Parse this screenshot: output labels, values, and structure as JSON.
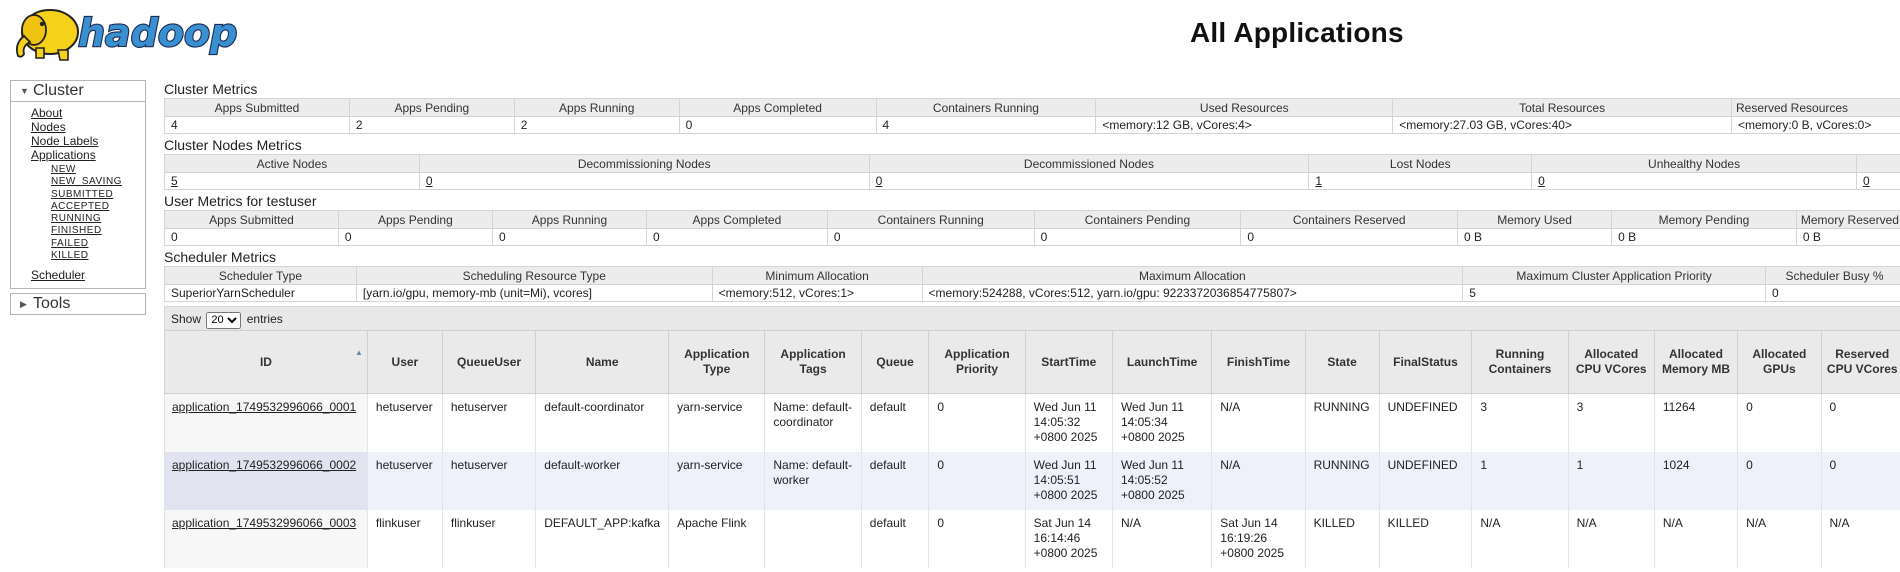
{
  "page": {
    "title": "All Applications"
  },
  "sidebar": {
    "cluster": {
      "header": "Cluster",
      "links": [
        "About",
        "Nodes",
        "Node Labels",
        "Applications"
      ],
      "app_states": [
        "NEW",
        "NEW_SAVING",
        "SUBMITTED",
        "ACCEPTED",
        "RUNNING",
        "FINISHED",
        "FAILED",
        "KILLED"
      ],
      "scheduler": "Scheduler"
    },
    "tools": {
      "header": "Tools"
    }
  },
  "cluster_metrics": {
    "title": "Cluster Metrics",
    "headers": [
      "Apps Submitted",
      "Apps Pending",
      "Apps Running",
      "Apps Completed",
      "Containers Running",
      "Used Resources",
      "Total Resources",
      "Reserved Resources"
    ],
    "values": [
      "4",
      "2",
      "2",
      "0",
      "4",
      "<memory:12 GB, vCores:4>",
      "<memory:27.03 GB, vCores:40>",
      "<memory:0 B, vCores:0>"
    ]
  },
  "cluster_nodes_metrics": {
    "title": "Cluster Nodes Metrics",
    "headers": [
      "Active Nodes",
      "Decommissioning Nodes",
      "Decommissioned Nodes",
      "Lost Nodes",
      "Unhealthy Nodes",
      ""
    ],
    "values": [
      "5",
      "0",
      "0",
      "1",
      "0",
      "0"
    ]
  },
  "user_metrics": {
    "title": "User Metrics for testuser",
    "headers": [
      "Apps Submitted",
      "Apps Pending",
      "Apps Running",
      "Apps Completed",
      "Containers Running",
      "Containers Pending",
      "Containers Reserved",
      "Memory Used",
      "Memory Pending",
      "Memory Reserved"
    ],
    "values": [
      "0",
      "0",
      "0",
      "0",
      "0",
      "0",
      "0",
      "0 B",
      "0 B",
      "0 B"
    ]
  },
  "scheduler_metrics": {
    "title": "Scheduler Metrics",
    "headers": [
      "Scheduler Type",
      "Scheduling Resource Type",
      "Minimum Allocation",
      "Maximum Allocation",
      "Maximum Cluster Application Priority",
      "Scheduler Busy %"
    ],
    "values": [
      "SuperiorYarnScheduler",
      "[yarn.io/gpu, memory-mb (unit=Mi), vcores]",
      "<memory:512, vCores:1>",
      "<memory:524288, vCores:512, yarn.io/gpu: 9223372036854775807>",
      "5",
      "0"
    ]
  },
  "apps_table": {
    "show_label": "Show",
    "entries_value": "20",
    "entries_label": "entries",
    "headers": [
      "ID",
      "User",
      "QueueUser",
      "Name",
      "Application Type",
      "Application Tags",
      "Queue",
      "Application Priority",
      "StartTime",
      "LaunchTime",
      "FinishTime",
      "State",
      "FinalStatus",
      "Running Containers",
      "Allocated CPU VCores",
      "Allocated Memory MB",
      "Allocated GPUs",
      "Reserved CPU VCores"
    ],
    "rows": [
      [
        "application_1749532996066_0001",
        "hetuserver",
        "hetuserver",
        "default-coordinator",
        "yarn-service",
        "Name: default-coordinator",
        "default",
        "0",
        "Wed Jun 11 14:05:32 +0800 2025",
        "Wed Jun 11 14:05:34 +0800 2025",
        "N/A",
        "RUNNING",
        "UNDEFINED",
        "3",
        "3",
        "11264",
        "0",
        "0"
      ],
      [
        "application_1749532996066_0002",
        "hetuserver",
        "hetuserver",
        "default-worker",
        "yarn-service",
        "Name: default-worker",
        "default",
        "0",
        "Wed Jun 11 14:05:51 +0800 2025",
        "Wed Jun 11 14:05:52 +0800 2025",
        "N/A",
        "RUNNING",
        "UNDEFINED",
        "1",
        "1",
        "1024",
        "0",
        "0"
      ],
      [
        "application_1749532996066_0003",
        "flinkuser",
        "flinkuser",
        "DEFAULT_APP:kafka",
        "Apache Flink",
        "",
        "default",
        "0",
        "Sat Jun 14 16:14:46 +0800 2025",
        "N/A",
        "Sat Jun 14 16:19:26 +0800 2025",
        "KILLED",
        "KILLED",
        "N/A",
        "N/A",
        "N/A",
        "N/A",
        "N/A"
      ]
    ]
  }
}
